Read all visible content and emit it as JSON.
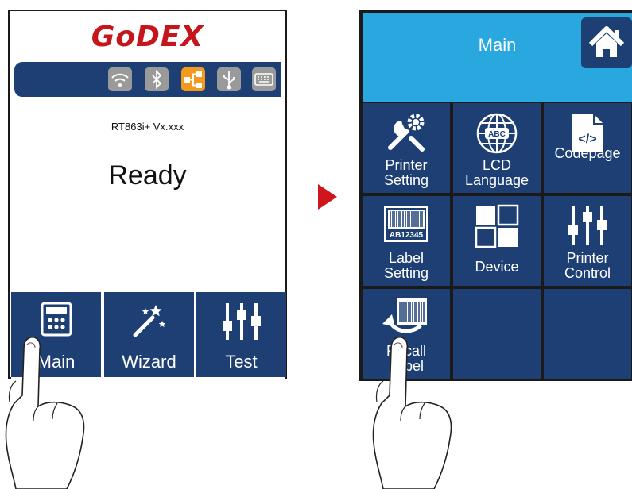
{
  "left_screen": {
    "logo": "GoDEX",
    "status_icons": [
      "wifi-icon",
      "bluetooth-icon",
      "ethernet-icon",
      "usb-icon",
      "keyboard-icon"
    ],
    "active_status_icon": "ethernet-icon",
    "model": "RT863i+ Vx.xxx",
    "status": "Ready",
    "buttons": [
      {
        "label": "Main",
        "icon": "calculator-icon"
      },
      {
        "label": "Wizard",
        "icon": "magic-wand-icon"
      },
      {
        "label": "Test",
        "icon": "sliders-icon"
      }
    ]
  },
  "right_screen": {
    "title": "Main",
    "home_icon": "home-icon",
    "menu": [
      {
        "label": "Printer\nSetting",
        "icon": "tools-icon"
      },
      {
        "label": "LCD\nLanguage",
        "icon": "globe-icon",
        "icon_text": "ABC"
      },
      {
        "label": "Codepage",
        "icon": "code-file-icon",
        "icon_text": "</>"
      },
      {
        "label": "Label\nSetting",
        "icon": "barcode-icon",
        "icon_text": "AB12345"
      },
      {
        "label": "Device",
        "icon": "grid-icon"
      },
      {
        "label": "Printer\nControl",
        "icon": "sliders-icon"
      },
      {
        "label": "Recall\nLabel",
        "icon": "recall-barcode-icon"
      }
    ]
  },
  "colors": {
    "navy": "#1d3f73",
    "header_blue": "#29a8e0",
    "logo_red": "#c4161c",
    "active_orange": "#f39a1d",
    "arrow_red": "#d0151c"
  }
}
